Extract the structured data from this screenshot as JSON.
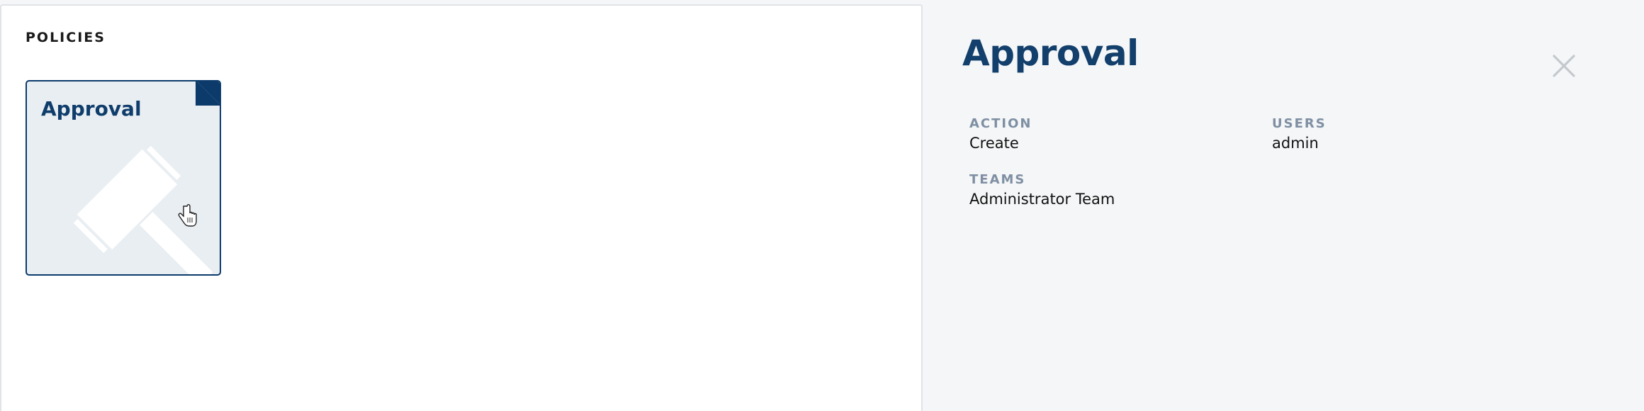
{
  "policies": {
    "section_title": "POLICIES",
    "cards": [
      {
        "title": "Approval",
        "icon": "gavel-icon"
      }
    ]
  },
  "detail": {
    "title": "Approval",
    "close_icon": "close-icon",
    "fields": {
      "action_label": "ACTION",
      "action_value": "Create",
      "users_label": "USERS",
      "users_value": "admin",
      "teams_label": "TEAMS",
      "teams_value": "Administrator Team"
    }
  },
  "colors": {
    "accent": "#0b3a6b",
    "title": "#123f6b",
    "label": "#7f8fa3",
    "card_bg": "#e9eef2",
    "panel_bg": "#f4f6f7"
  }
}
